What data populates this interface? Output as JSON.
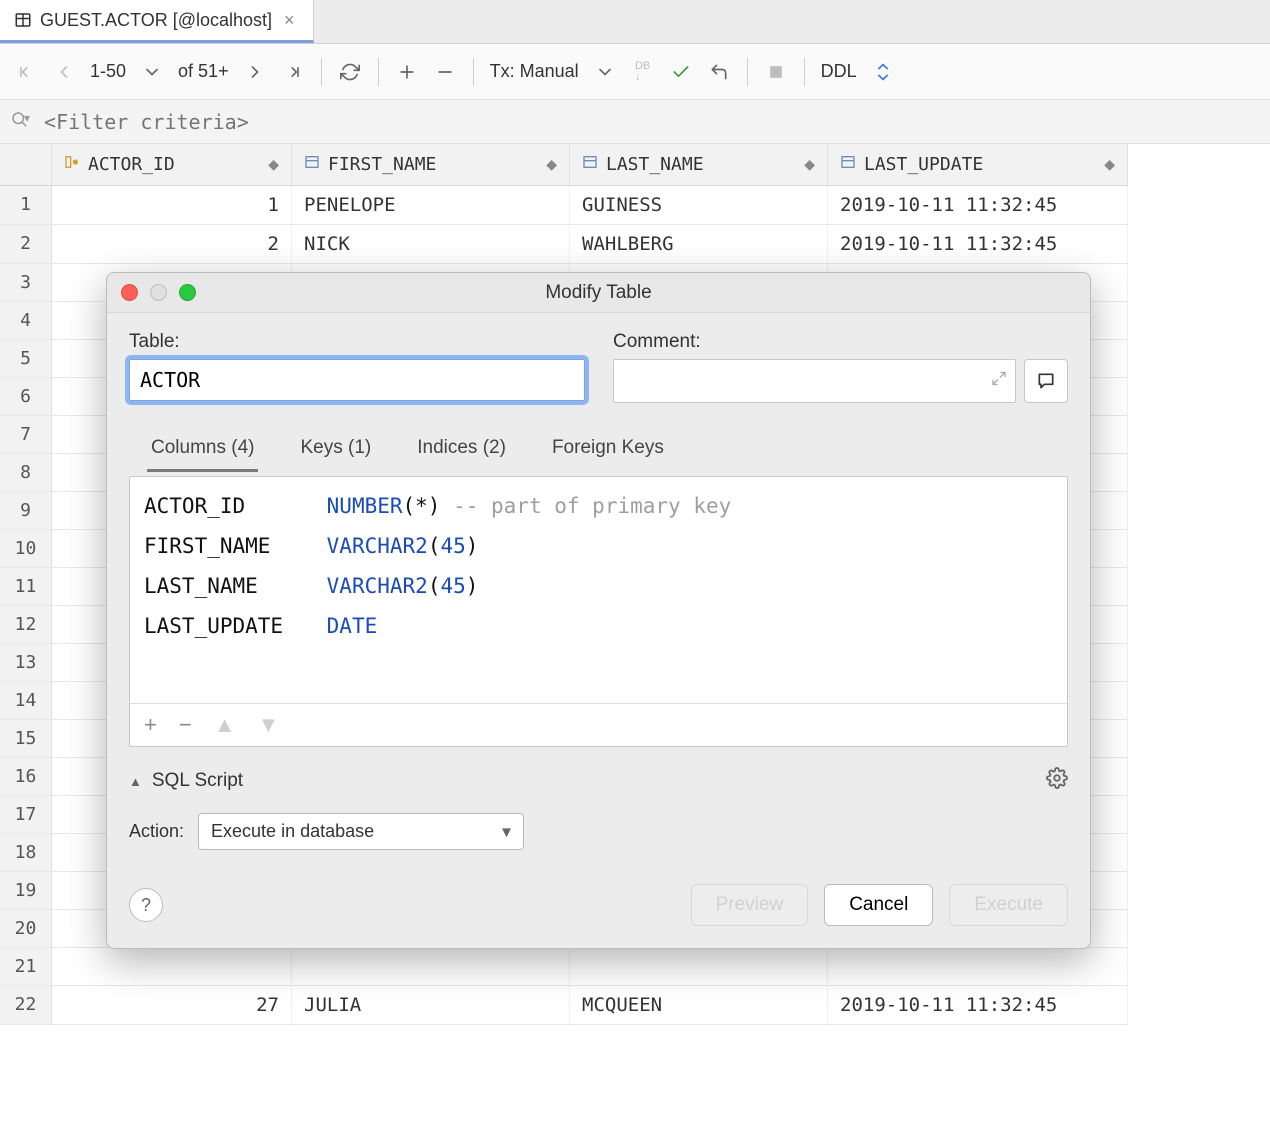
{
  "tab": {
    "title": "GUEST.ACTOR [@localhost]"
  },
  "toolbar": {
    "page_range": "1-50",
    "of": "of 51+",
    "tx": "Tx: Manual",
    "ddl": "DDL"
  },
  "filter": {
    "placeholder": "<Filter criteria>"
  },
  "columns": [
    "ACTOR_ID",
    "FIRST_NAME",
    "LAST_NAME",
    "LAST_UPDATE"
  ],
  "rows": [
    {
      "n": "1",
      "id": "1",
      "first": "PENELOPE",
      "last": "GUINESS",
      "upd": "2019-10-11 11:32:45"
    },
    {
      "n": "2",
      "id": "2",
      "first": "NICK",
      "last": "WAHLBERG",
      "upd": "2019-10-11 11:32:45"
    },
    {
      "n": "3",
      "id": "",
      "first": "",
      "last": "",
      "upd": ""
    },
    {
      "n": "4",
      "id": "",
      "first": "",
      "last": "",
      "upd": ""
    },
    {
      "n": "5",
      "id": "",
      "first": "",
      "last": "",
      "upd": ""
    },
    {
      "n": "6",
      "id": "",
      "first": "",
      "last": "",
      "upd": ""
    },
    {
      "n": "7",
      "id": "",
      "first": "",
      "last": "",
      "upd": ""
    },
    {
      "n": "8",
      "id": "",
      "first": "",
      "last": "",
      "upd": ""
    },
    {
      "n": "9",
      "id": "",
      "first": "",
      "last": "",
      "upd": ""
    },
    {
      "n": "10",
      "id": "",
      "first": "",
      "last": "",
      "upd": ""
    },
    {
      "n": "11",
      "id": "",
      "first": "",
      "last": "",
      "upd": ""
    },
    {
      "n": "12",
      "id": "",
      "first": "",
      "last": "",
      "upd": ""
    },
    {
      "n": "13",
      "id": "",
      "first": "",
      "last": "",
      "upd": ""
    },
    {
      "n": "14",
      "id": "",
      "first": "",
      "last": "",
      "upd": ""
    },
    {
      "n": "15",
      "id": "",
      "first": "",
      "last": "",
      "upd": ""
    },
    {
      "n": "16",
      "id": "",
      "first": "",
      "last": "",
      "upd": ""
    },
    {
      "n": "17",
      "id": "",
      "first": "",
      "last": "",
      "upd": ""
    },
    {
      "n": "18",
      "id": "",
      "first": "",
      "last": "",
      "upd": ""
    },
    {
      "n": "19",
      "id": "",
      "first": "",
      "last": "",
      "upd": ""
    },
    {
      "n": "20",
      "id": "",
      "first": "",
      "last": "",
      "upd": ""
    },
    {
      "n": "21",
      "id": "",
      "first": "",
      "last": "",
      "upd": ""
    },
    {
      "n": "22",
      "id": "27",
      "first": "JULIA",
      "last": "MCQUEEN",
      "upd": "2019-10-11 11:32:45"
    }
  ],
  "modal": {
    "title": "Modify Table",
    "table_label": "Table:",
    "table_value": "ACTOR",
    "comment_label": "Comment:",
    "tabs": {
      "columns": "Columns (4)",
      "keys": "Keys (1)",
      "indices": "Indices (2)",
      "fkeys": "Foreign Keys"
    },
    "cols": [
      {
        "name": "ACTOR_ID",
        "type": "NUMBER",
        "args": "(*)",
        "comment": " -- part of primary key"
      },
      {
        "name": "FIRST_NAME",
        "type": "VARCHAR2",
        "args_open": "(",
        "num": "45",
        "args_close": ")",
        "comment": ""
      },
      {
        "name": "LAST_NAME",
        "type": "VARCHAR2",
        "args_open": "(",
        "num": "45",
        "args_close": ")",
        "comment": ""
      },
      {
        "name": "LAST_UPDATE",
        "type": "DATE",
        "args": "",
        "comment": ""
      }
    ],
    "script_header": "SQL Script",
    "action_label": "Action:",
    "action_value": "Execute in database",
    "buttons": {
      "preview": "Preview",
      "cancel": "Cancel",
      "execute": "Execute"
    }
  }
}
